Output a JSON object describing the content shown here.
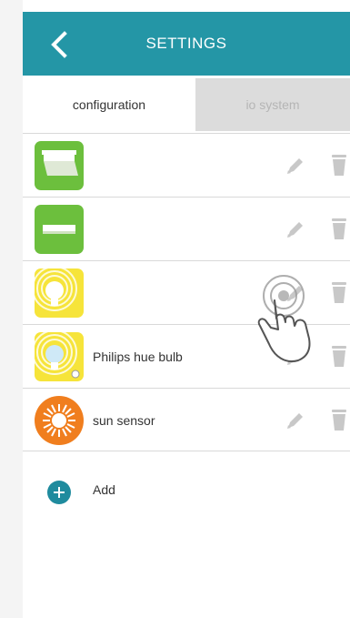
{
  "header": {
    "title": "SETTINGS",
    "background_color": "#2496a6"
  },
  "tabs": [
    {
      "label": "configuration",
      "active": true
    },
    {
      "label": "io system",
      "active": false
    }
  ],
  "devices": [
    {
      "label": "",
      "icon": "green-shade-icon"
    },
    {
      "label": "",
      "icon": "green-light-bar-icon"
    },
    {
      "label": "",
      "icon": "yellow-bulb-icon"
    },
    {
      "label": "Philips hue bulb",
      "icon": "hue-bulb-icon"
    },
    {
      "label": "sun sensor",
      "icon": "sun-sensor-icon"
    }
  ],
  "add": {
    "label": "Add"
  },
  "colors": {
    "accent": "#2496a6",
    "green": "#6cbf3d",
    "yellow": "#f6e43a",
    "orange": "#f07e1e"
  }
}
